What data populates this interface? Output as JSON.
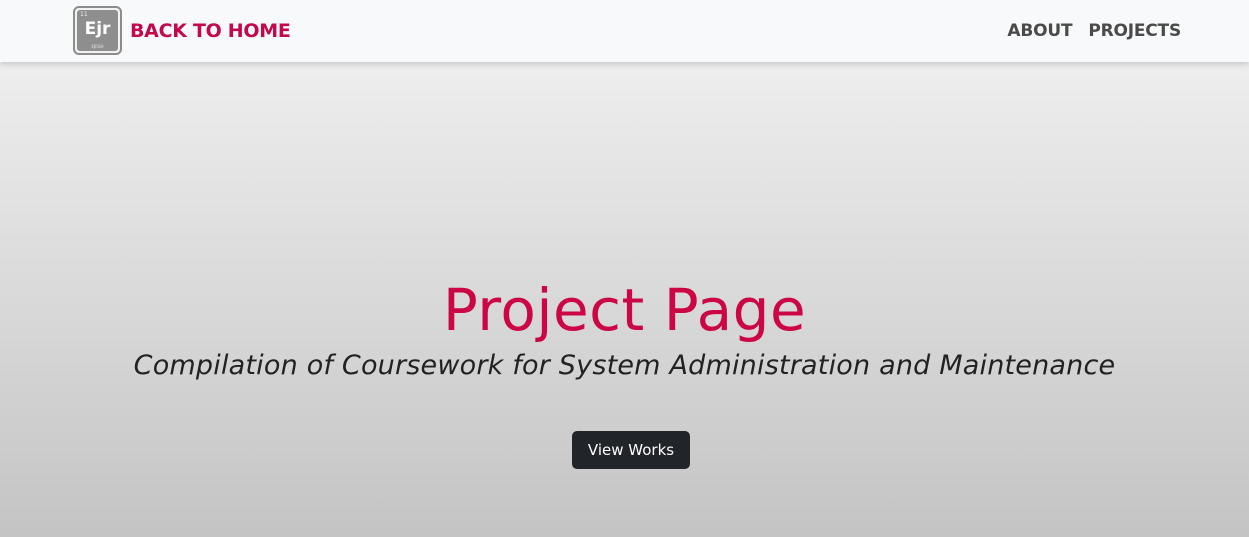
{
  "navbar": {
    "logo": {
      "atomic_number": "11",
      "symbol": "Ejr",
      "name": "EJRSH"
    },
    "brand_label": "BACK TO HOME",
    "links": [
      "ABOUT",
      "PROJECTS"
    ]
  },
  "hero": {
    "title": "Project Page",
    "subtitle": "Compilation of Coursework for System Administration and Maintenance",
    "button_label": "View Works"
  },
  "colors": {
    "accent": "#cc0645",
    "brand_text": "#c3094d",
    "nav_link": "#4a4a4a",
    "button_bg": "#212529",
    "navbar_bg": "#f8f9fa"
  }
}
